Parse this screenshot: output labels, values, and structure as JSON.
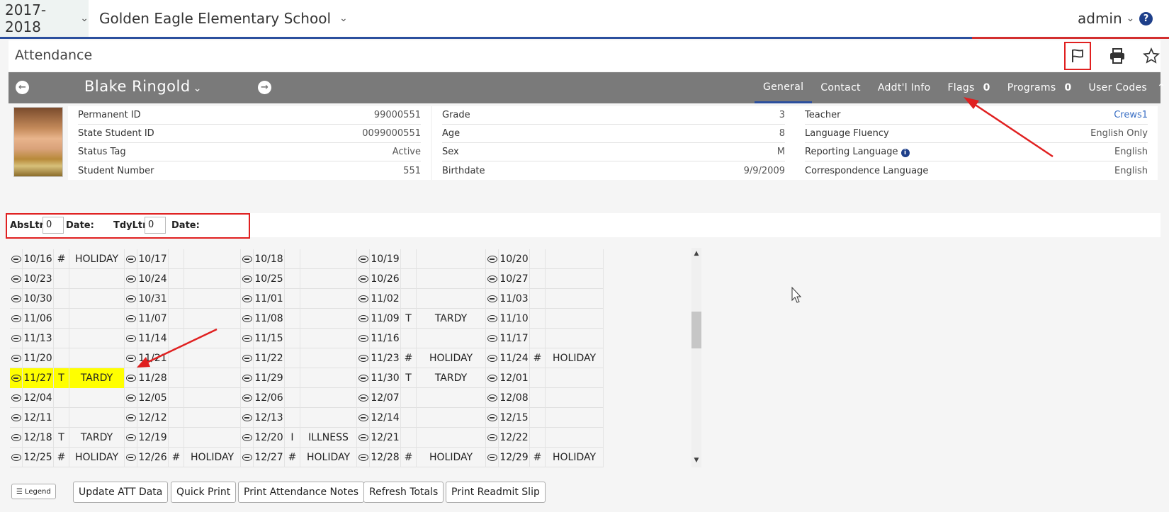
{
  "topbar": {
    "year": "2017-2018",
    "school": "Golden Eagle Elementary School",
    "user": "admin",
    "help_icon": "question-icon"
  },
  "page": {
    "title": "Attendance",
    "icons": [
      "flag-icon",
      "print-icon",
      "star-icon"
    ]
  },
  "student": {
    "name": "Blake Ringold",
    "tabs": [
      {
        "label": "General",
        "count": "",
        "active": true
      },
      {
        "label": "Contact",
        "count": ""
      },
      {
        "label": "Addt'l Info",
        "count": ""
      },
      {
        "label": "Flags",
        "count": "0"
      },
      {
        "label": "Programs",
        "count": "0"
      },
      {
        "label": "User Codes",
        "count": ""
      }
    ]
  },
  "info": {
    "col1": [
      {
        "label": "Permanent ID",
        "value": "99000551"
      },
      {
        "label": "State Student ID",
        "value": "0099000551"
      },
      {
        "label": "Status Tag",
        "value": "Active"
      },
      {
        "label": "Student Number",
        "value": "551"
      }
    ],
    "col2": [
      {
        "label": "Grade",
        "value": "3"
      },
      {
        "label": "Age",
        "value": "8"
      },
      {
        "label": "Sex",
        "value": "M"
      },
      {
        "label": "Birthdate",
        "value": "9/9/2009"
      }
    ],
    "col3": [
      {
        "label": "Teacher",
        "value": "Crews1"
      },
      {
        "label": "Language Fluency",
        "value": "English Only"
      },
      {
        "label": "Reporting Language",
        "value": "English"
      },
      {
        "label": "Correspondence Language",
        "value": "English"
      }
    ]
  },
  "letters": {
    "abs_label": "AbsLtr:",
    "abs_value": "0",
    "abs_date_label": "Date:",
    "tdy_label": "TdyLtr:",
    "tdy_value": "0",
    "tdy_date_label": "Date:"
  },
  "calendar": {
    "rows": [
      [
        [
          "10/16",
          "#",
          "HOLIDAY"
        ],
        [
          "10/17",
          "",
          ""
        ],
        [
          "10/18",
          "",
          ""
        ],
        [
          "10/19",
          "",
          ""
        ],
        [
          "10/20",
          "",
          ""
        ]
      ],
      [
        [
          "10/23",
          "",
          ""
        ],
        [
          "10/24",
          "",
          ""
        ],
        [
          "10/25",
          "",
          ""
        ],
        [
          "10/26",
          "",
          ""
        ],
        [
          "10/27",
          "",
          ""
        ]
      ],
      [
        [
          "10/30",
          "",
          ""
        ],
        [
          "10/31",
          "",
          ""
        ],
        [
          "11/01",
          "",
          ""
        ],
        [
          "11/02",
          "",
          ""
        ],
        [
          "11/03",
          "",
          ""
        ]
      ],
      [
        [
          "11/06",
          "",
          ""
        ],
        [
          "11/07",
          "",
          ""
        ],
        [
          "11/08",
          "",
          ""
        ],
        [
          "11/09",
          "T",
          "TARDY"
        ],
        [
          "11/10",
          "",
          ""
        ]
      ],
      [
        [
          "11/13",
          "",
          ""
        ],
        [
          "11/14",
          "",
          ""
        ],
        [
          "11/15",
          "",
          ""
        ],
        [
          "11/16",
          "",
          ""
        ],
        [
          "11/17",
          "",
          ""
        ]
      ],
      [
        [
          "11/20",
          "",
          ""
        ],
        [
          "11/21",
          "",
          ""
        ],
        [
          "11/22",
          "",
          ""
        ],
        [
          "11/23",
          "#",
          "HOLIDAY"
        ],
        [
          "11/24",
          "#",
          "HOLIDAY"
        ]
      ],
      [
        [
          "11/27",
          "T",
          "TARDY"
        ],
        [
          "11/28",
          "",
          ""
        ],
        [
          "11/29",
          "",
          ""
        ],
        [
          "11/30",
          "T",
          "TARDY"
        ],
        [
          "12/01",
          "",
          ""
        ]
      ],
      [
        [
          "12/04",
          "",
          ""
        ],
        [
          "12/05",
          "",
          ""
        ],
        [
          "12/06",
          "",
          ""
        ],
        [
          "12/07",
          "",
          ""
        ],
        [
          "12/08",
          "",
          ""
        ]
      ],
      [
        [
          "12/11",
          "",
          ""
        ],
        [
          "12/12",
          "",
          ""
        ],
        [
          "12/13",
          "",
          ""
        ],
        [
          "12/14",
          "",
          ""
        ],
        [
          "12/15",
          "",
          ""
        ]
      ],
      [
        [
          "12/18",
          "T",
          "TARDY"
        ],
        [
          "12/19",
          "",
          ""
        ],
        [
          "12/20",
          "I",
          "ILLNESS"
        ],
        [
          "12/21",
          "",
          ""
        ],
        [
          "12/22",
          "",
          ""
        ]
      ],
      [
        [
          "12/25",
          "#",
          "HOLIDAY"
        ],
        [
          "12/26",
          "#",
          "HOLIDAY"
        ],
        [
          "12/27",
          "#",
          "HOLIDAY"
        ],
        [
          "12/28",
          "#",
          "HOLIDAY"
        ],
        [
          "12/29",
          "#",
          "HOLIDAY"
        ]
      ]
    ],
    "highlight_color": "#ffff00"
  },
  "buttons": {
    "legend": "Legend",
    "update": "Update ATT Data",
    "quick_print": "Quick Print",
    "print_notes": "Print Attendance Notes",
    "refresh": "Refresh Totals",
    "readmit": "Print Readmit Slip"
  },
  "colors": {
    "accent": "#2b4f9e",
    "annotation": "#e02020",
    "student_bar": "#7a7a7a",
    "link": "#3a6fc4"
  }
}
